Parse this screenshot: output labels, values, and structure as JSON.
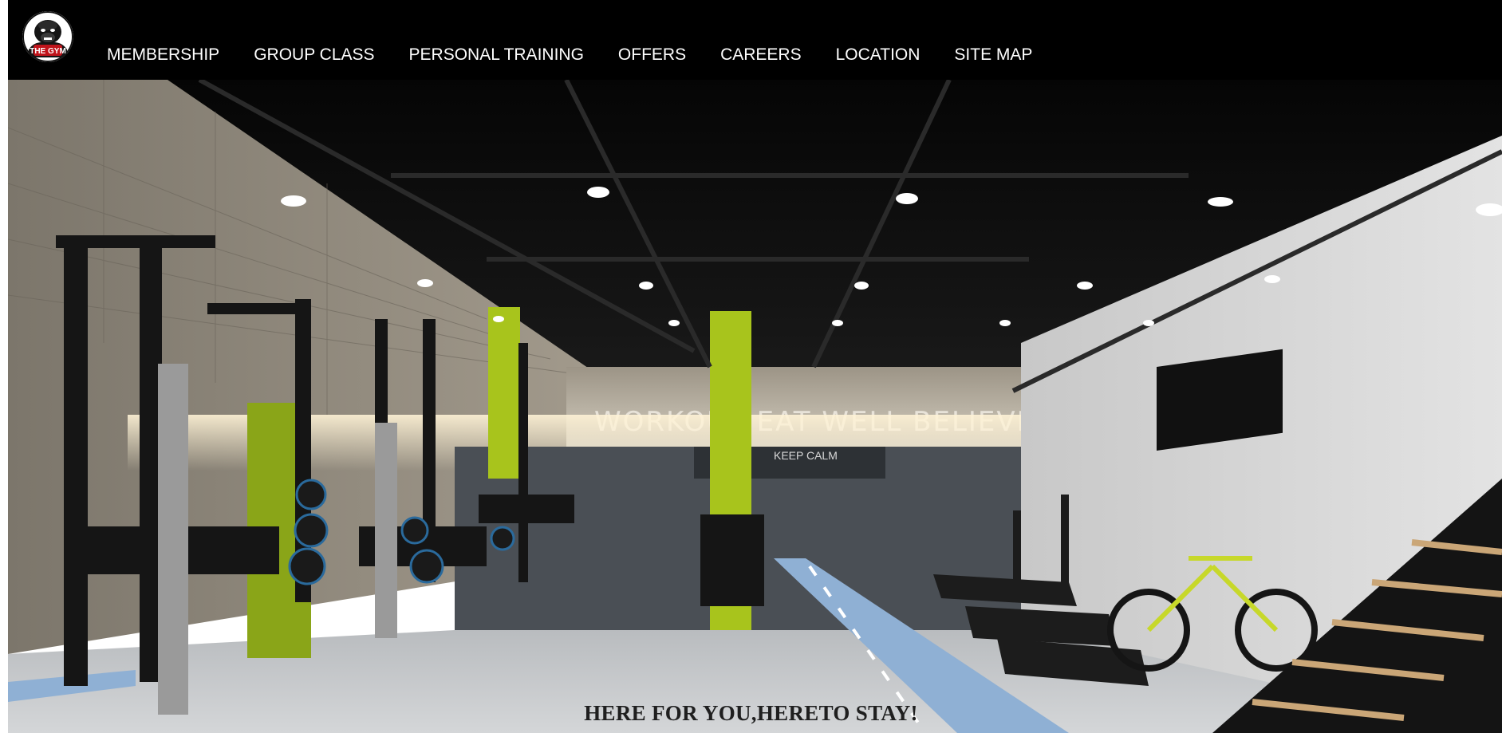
{
  "brand": {
    "logo_icon": "gorilla-logo-icon",
    "logo_text": "THE GYM"
  },
  "nav": {
    "items": [
      {
        "label": "MEMBERSHIP"
      },
      {
        "label": "GROUP CLASS"
      },
      {
        "label": "PERSONAL TRAINING"
      },
      {
        "label": "OFFERS"
      },
      {
        "label": "CAREERS"
      },
      {
        "label": "LOCATION"
      },
      {
        "label": "SITE MAP"
      }
    ]
  },
  "hero": {
    "image_subject": "gym-interior-photo",
    "wall_lettering": "WORKOUT  EAT WELL  BELIEVE",
    "mirror_lettering": "KEEP CALM",
    "tagline": "HERE FOR YOU,HERETO STAY!"
  },
  "colors": {
    "nav_background": "#000000",
    "nav_text": "#ffffff",
    "accent_lime": "#a8c41c",
    "track_blue": "#8fb0d4",
    "tagline_text": "#1f1f1f"
  }
}
